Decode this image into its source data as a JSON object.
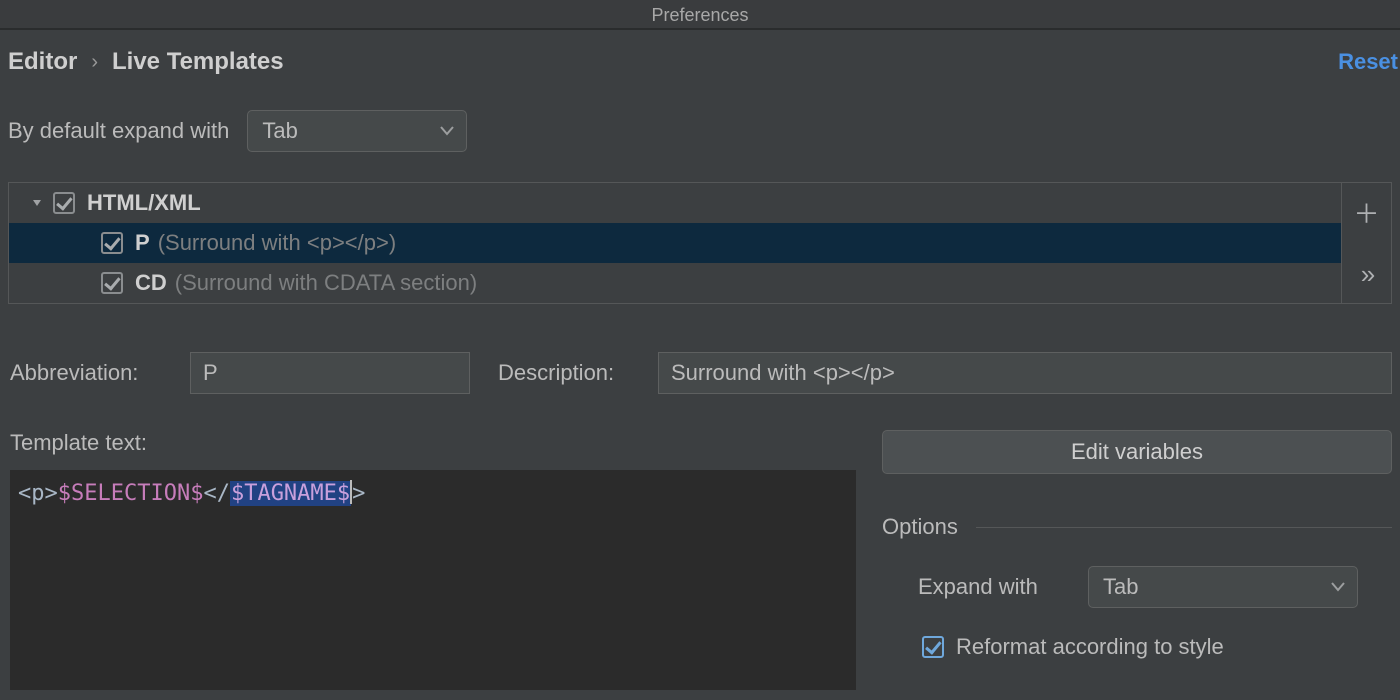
{
  "window_title": "Preferences",
  "breadcrumb": {
    "root": "Editor",
    "current": "Live Templates"
  },
  "reset_label": "Reset",
  "expand": {
    "label": "By default expand with",
    "value": "Tab"
  },
  "tree": {
    "group": "HTML/XML",
    "items": [
      {
        "code": "P",
        "desc": "(Surround with <p></p>)"
      },
      {
        "code": "CD",
        "desc": "(Surround with CDATA section)"
      }
    ]
  },
  "abbrev": {
    "label": "Abbreviation:",
    "value": "P"
  },
  "description": {
    "label": "Description:",
    "value": "Surround with <p></p>"
  },
  "template": {
    "label": "Template text:",
    "prefix": "<p>",
    "var1": "$SELECTION$",
    "mid": "</",
    "var2": "$TAGNAME$",
    "suffix": ">"
  },
  "edit_vars_label": "Edit variables",
  "options": {
    "header": "Options",
    "expand_label": "Expand with",
    "expand_value": "Tab",
    "reformat_label": "Reformat according to style"
  }
}
